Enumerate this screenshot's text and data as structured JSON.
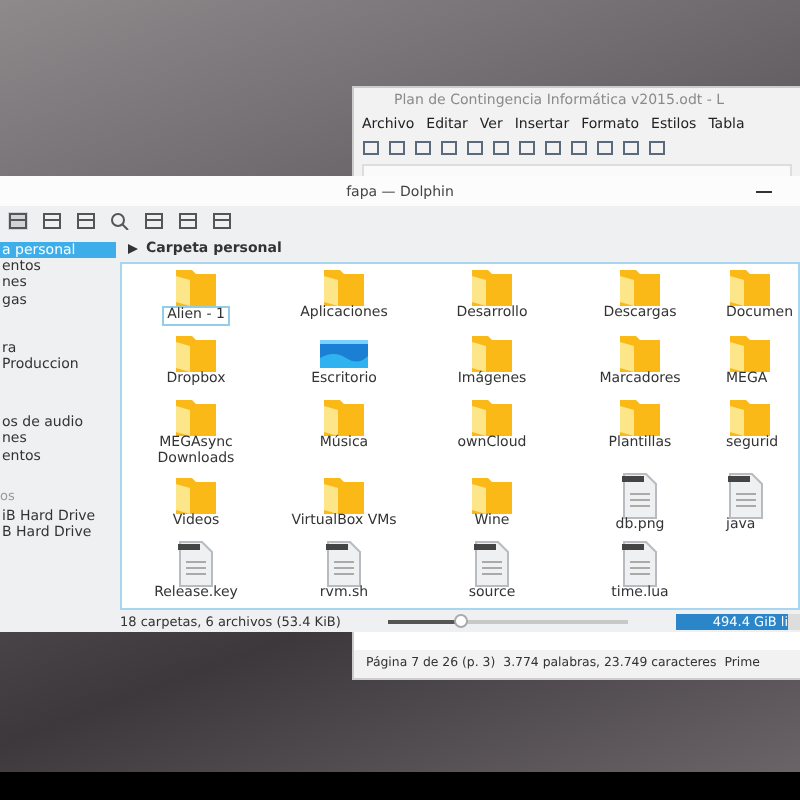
{
  "writer": {
    "title": "Plan de Contingencia Informática v2015.odt - L",
    "menu": [
      "Archivo",
      "Editar",
      "Ver",
      "Insertar",
      "Formato",
      "Estilos",
      "Tabla"
    ],
    "status_bar": [
      "Página 7 de 26 (p. 3)",
      "3.774 palabras, 23.749 caracteres",
      "Prime"
    ]
  },
  "dolphin": {
    "title": "fapa — Dolphin",
    "sidebar": [
      {
        "label": "a personal",
        "kind": "item",
        "selected": true
      },
      {
        "label": "entos",
        "kind": "item",
        "selected": false
      },
      {
        "label": "nes",
        "kind": "item",
        "selected": false
      },
      {
        "label": "gas",
        "kind": "item",
        "selected": false
      },
      {
        "label": "ra",
        "kind": "item",
        "selected": false
      },
      {
        "label": " Produccion",
        "kind": "item",
        "selected": false
      },
      {
        "label": "os de audio",
        "kind": "item",
        "selected": false
      },
      {
        "label": "nes",
        "kind": "item",
        "selected": false
      },
      {
        "label": "entos",
        "kind": "item",
        "selected": false
      },
      {
        "label": "os",
        "kind": "heading",
        "selected": false
      },
      {
        "label": "iB Hard Drive",
        "kind": "item",
        "selected": false
      },
      {
        "label": "B Hard Drive",
        "kind": "item",
        "selected": false
      }
    ],
    "location": "Carpeta personal",
    "files": [
      {
        "name": "Alien - 1",
        "kind": "folder",
        "selected": true
      },
      {
        "name": "Aplicaciones",
        "kind": "folder",
        "selected": false
      },
      {
        "name": "Desarrollo",
        "kind": "folder",
        "selected": false
      },
      {
        "name": "Descargas",
        "kind": "folder",
        "selected": false
      },
      {
        "name": "Documen",
        "kind": "folder",
        "selected": false
      },
      {
        "name": "Dropbox",
        "kind": "folder",
        "selected": false
      },
      {
        "name": "Escritorio",
        "kind": "desktop",
        "selected": false
      },
      {
        "name": "Imágenes",
        "kind": "folder",
        "selected": false
      },
      {
        "name": "Marcadores",
        "kind": "folder",
        "selected": false
      },
      {
        "name": "MEGA",
        "kind": "folder",
        "selected": false
      },
      {
        "name": "MEGAsync Downloads",
        "kind": "folder",
        "selected": false
      },
      {
        "name": "Música",
        "kind": "folder",
        "selected": false
      },
      {
        "name": "ownCloud",
        "kind": "folder",
        "selected": false
      },
      {
        "name": "Plantillas",
        "kind": "folder",
        "selected": false
      },
      {
        "name": "segurid",
        "kind": "folder",
        "selected": false
      },
      {
        "name": "Videos",
        "kind": "folder",
        "selected": false
      },
      {
        "name": "VirtualBox VMs",
        "kind": "folder",
        "selected": false
      },
      {
        "name": "Wine",
        "kind": "folder",
        "selected": false
      },
      {
        "name": "db.png",
        "kind": "file",
        "selected": false
      },
      {
        "name": "java",
        "kind": "file",
        "selected": false
      },
      {
        "name": "Release.key",
        "kind": "file",
        "selected": false
      },
      {
        "name": "rvm.sh",
        "kind": "file",
        "selected": false
      },
      {
        "name": "source",
        "kind": "file",
        "selected": false
      },
      {
        "name": "time.lua",
        "kind": "file",
        "selected": false
      }
    ],
    "status": "18 carpetas, 6 archivos (53.4 KiB)",
    "zoom": {
      "level": 0.3
    },
    "free_space": {
      "label": "494.4 GiB li",
      "level": 0.9
    }
  }
}
